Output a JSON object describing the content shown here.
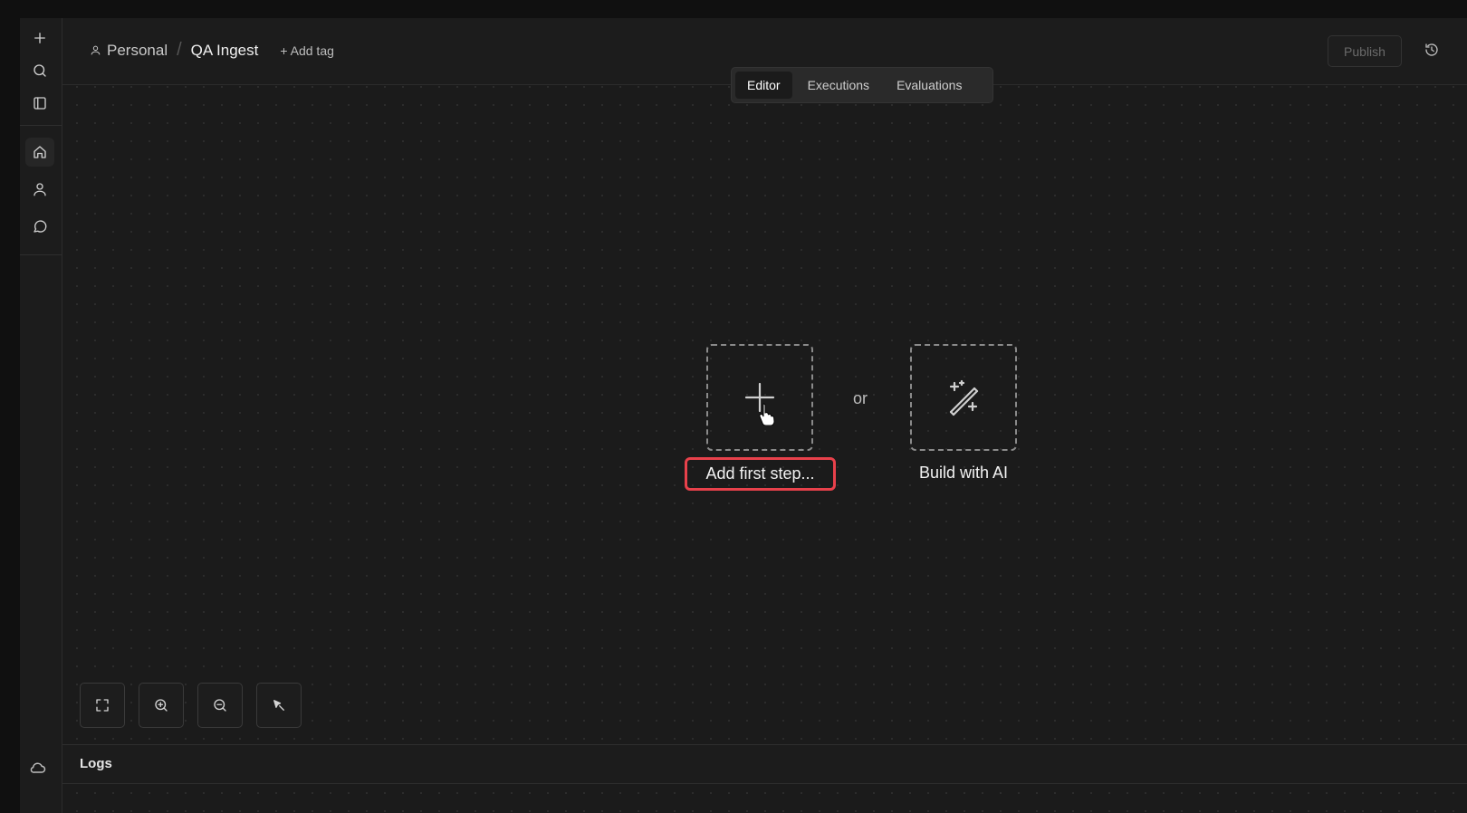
{
  "breadcrumb": {
    "project": "Personal",
    "separator": "/",
    "workflow_name": "QA Ingest",
    "add_tag": "+ Add tag"
  },
  "header": {
    "publish_label": "Publish",
    "history_icon": "history-icon"
  },
  "tabs": [
    {
      "label": "Editor",
      "active": true
    },
    {
      "label": "Executions",
      "active": false
    },
    {
      "label": "Evaluations",
      "active": false
    }
  ],
  "sidebar": {
    "items": [
      {
        "icon": "plus-icon"
      },
      {
        "icon": "search-icon"
      },
      {
        "icon": "panel-icon"
      },
      {
        "icon": "home-icon",
        "active": true
      },
      {
        "icon": "user-icon"
      },
      {
        "icon": "chat-icon"
      }
    ],
    "bottom_icon": "cloud-icon"
  },
  "canvas": {
    "add_first_step_label": "Add first step...",
    "or_label": "or",
    "build_with_ai_label": "Build with AI",
    "highlight_color": "#e8414b"
  },
  "controls": [
    {
      "icon": "fit-view-icon"
    },
    {
      "icon": "zoom-in-icon"
    },
    {
      "icon": "zoom-out-icon"
    },
    {
      "icon": "tidy-up-icon"
    }
  ],
  "logs": {
    "title": "Logs"
  }
}
